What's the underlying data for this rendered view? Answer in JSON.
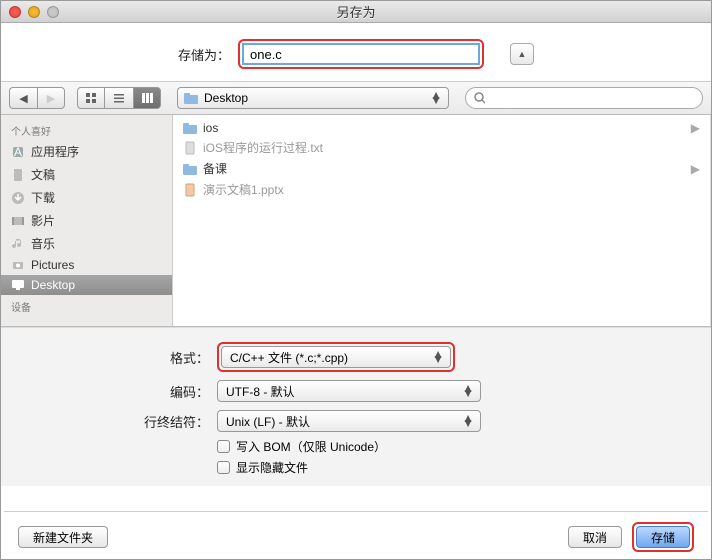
{
  "titlebar": {
    "title": "另存为"
  },
  "save_row": {
    "label": "存储为：",
    "filename": "one.c"
  },
  "toolbar": {
    "location": "Desktop",
    "search_placeholder": ""
  },
  "sidebar": {
    "fav_header": "个人喜好",
    "fav_items": [
      {
        "icon": "app-icon",
        "label": "应用程序"
      },
      {
        "icon": "doc-icon",
        "label": "文稿"
      },
      {
        "icon": "download-icon",
        "label": "下载"
      },
      {
        "icon": "movie-icon",
        "label": "影片"
      },
      {
        "icon": "music-icon",
        "label": "音乐"
      },
      {
        "icon": "pictures-icon",
        "label": "Pictures"
      },
      {
        "icon": "desktop-icon",
        "label": "Desktop"
      }
    ],
    "dev_header": "设备"
  },
  "files": [
    {
      "type": "folder",
      "name": "ios"
    },
    {
      "type": "file",
      "name": "iOS程序的运行过程.txt"
    },
    {
      "type": "folder",
      "name": "备课"
    },
    {
      "type": "file",
      "name": "演示文稿1.pptx"
    }
  ],
  "options": {
    "format_label": "格式：",
    "format_value": "C/C++ 文件 (*.c;*.cpp)",
    "encoding_label": "编码：",
    "encoding_value": "UTF-8 - 默认",
    "lineend_label": "行终结符：",
    "lineend_value": "Unix (LF) - 默认",
    "chk_bom": "写入 BOM（仅限 Unicode）",
    "chk_hidden": "显示隐藏文件"
  },
  "footer": {
    "new_folder": "新建文件夹",
    "cancel": "取消",
    "save": "存储"
  }
}
